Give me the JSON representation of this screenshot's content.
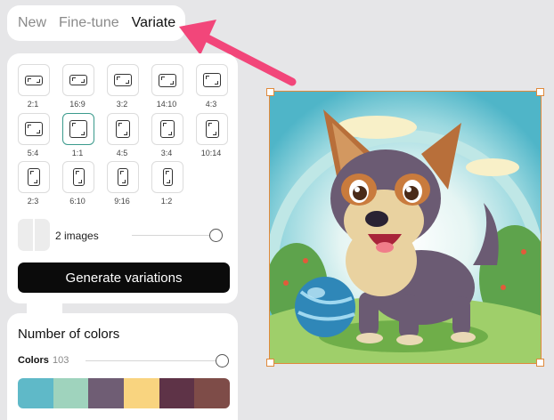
{
  "tabs": [
    {
      "label": "New",
      "active": false
    },
    {
      "label": "Fine-tune",
      "active": false
    },
    {
      "label": "Variate",
      "active": true
    }
  ],
  "aspect_ratios": [
    {
      "label": "2:1",
      "selected": false
    },
    {
      "label": "16:9",
      "selected": false
    },
    {
      "label": "3:2",
      "selected": false
    },
    {
      "label": "14:10",
      "selected": false
    },
    {
      "label": "4:3",
      "selected": false
    },
    {
      "label": "5:4",
      "selected": false
    },
    {
      "label": "1:1",
      "selected": true
    },
    {
      "label": "4:5",
      "selected": false
    },
    {
      "label": "3:4",
      "selected": false
    },
    {
      "label": "10:14",
      "selected": false
    },
    {
      "label": "2:3",
      "selected": false
    },
    {
      "label": "6:10",
      "selected": false
    },
    {
      "label": "9:16",
      "selected": false
    },
    {
      "label": "1:2",
      "selected": false
    }
  ],
  "images": {
    "label": "2 images",
    "slider_level": 1.0
  },
  "generate_button": "Generate variations",
  "colors": {
    "title": "Number of colors",
    "label": "Colors",
    "count": "103",
    "slider_level": 1.0,
    "swatches": [
      "#5fb9c8",
      "#9fd3bd",
      "#6f5d74",
      "#f9d47f",
      "#5e3347",
      "#7e4c48"
    ]
  },
  "arrow_color": "#f2467a",
  "selection_color": "#e08a3c"
}
